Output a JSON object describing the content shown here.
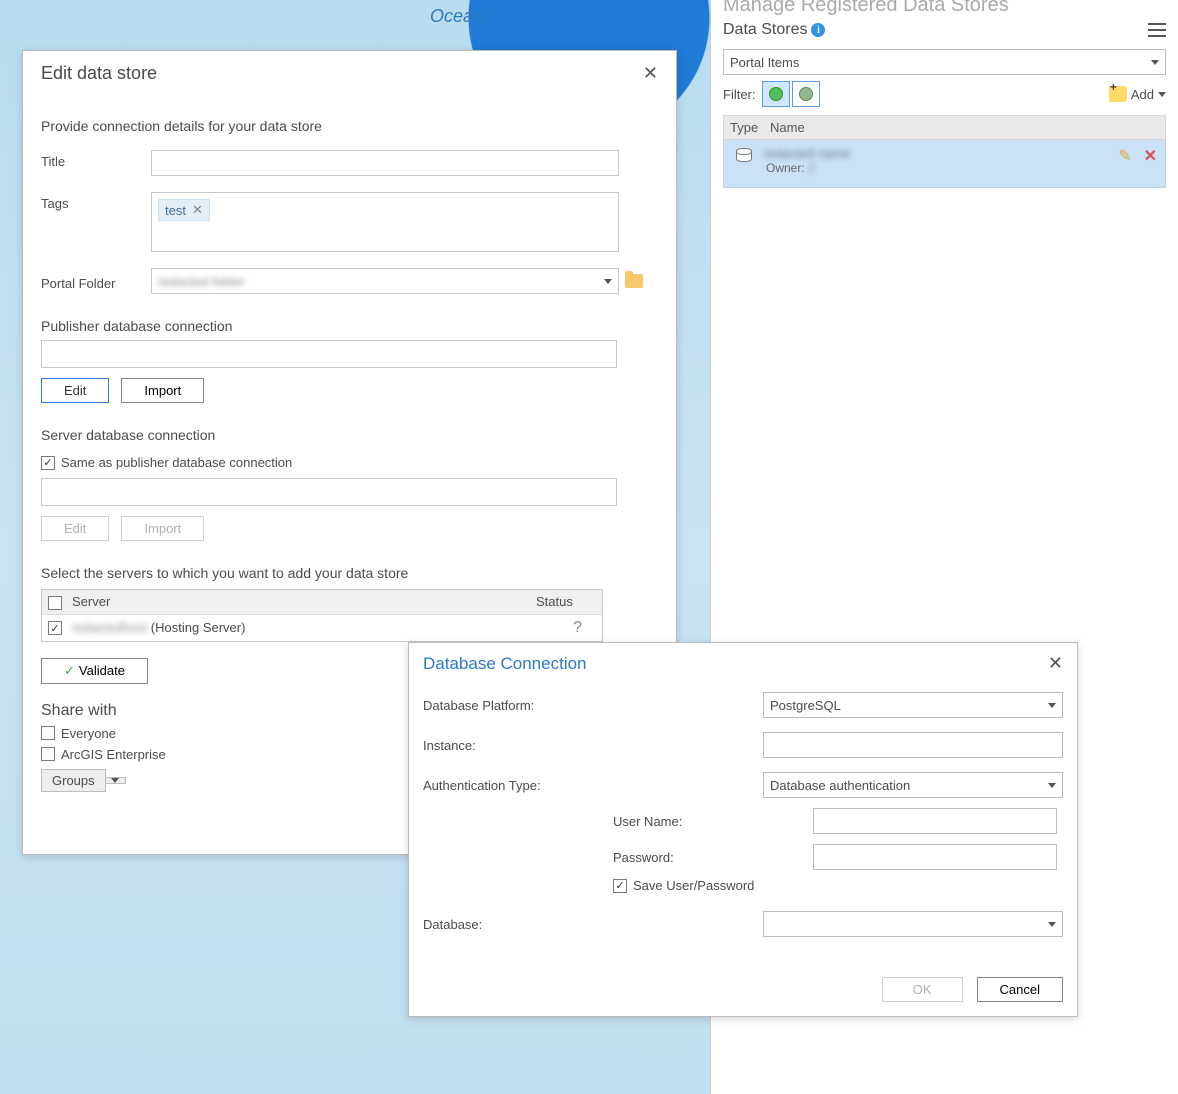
{
  "map": {
    "ocean_label": "Ocean"
  },
  "right_panel": {
    "title": "Manage Registered Data Stores",
    "heading": "Data Stores",
    "view_select": "Portal Items",
    "filter_label": "Filter:",
    "add_label": "Add",
    "table": {
      "col_type": "Type",
      "col_name": "Name"
    },
    "item": {
      "owner_label": "Owner:",
      "owner_value": "J"
    }
  },
  "edit_dialog": {
    "title": "Edit data store",
    "subtitle": "Provide connection details for your data store",
    "labels": {
      "title": "Title",
      "tags": "Tags",
      "portal_folder": "Portal Folder",
      "pub_conn": "Publisher database connection",
      "server_conn": "Server database connection",
      "same_as": "Same as publisher database connection",
      "select_servers": "Select the servers to which you want to add your data store",
      "share_with": "Share with",
      "everyone": "Everyone",
      "enterprise": "ArcGIS Enterprise",
      "groups": "Groups"
    },
    "tags": [
      "test"
    ],
    "buttons": {
      "edit": "Edit",
      "import": "Import",
      "validate": "Validate"
    },
    "server_table": {
      "col_server": "Server",
      "col_status": "Status",
      "rows": [
        {
          "checked": true,
          "name": "(Hosting Server)",
          "status": "?"
        }
      ]
    }
  },
  "db_dialog": {
    "title": "Database Connection",
    "labels": {
      "platform": "Database Platform:",
      "instance": "Instance:",
      "auth_type": "Authentication Type:",
      "username": "User Name:",
      "password": "Password:",
      "save_up": "Save User/Password",
      "database": "Database:"
    },
    "values": {
      "platform": "PostgreSQL",
      "auth_type": "Database authentication"
    },
    "buttons": {
      "ok": "OK",
      "cancel": "Cancel"
    }
  }
}
